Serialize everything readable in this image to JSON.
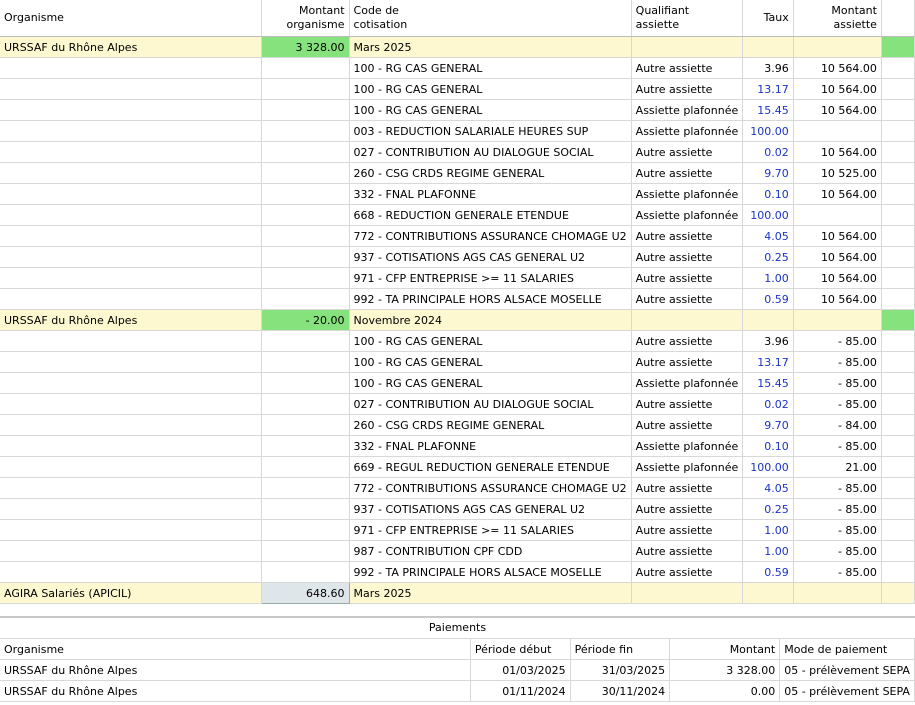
{
  "columns": {
    "organisme": "Organisme",
    "montant_organisme": [
      "Montant",
      "organisme"
    ],
    "code_cotisation": [
      "Code de",
      "cotisation"
    ],
    "qualifiant_assiette": [
      "Qualifiant",
      "assiette"
    ],
    "taux": "Taux",
    "montant_assiette": [
      "Montant",
      "assiette"
    ]
  },
  "groups": [
    {
      "organisme": "URSSAF du Rhône Alpes",
      "montant": "3 328.00",
      "periode": "Mars 2025",
      "rows": [
        {
          "code": "100 - RG CAS GENERAL",
          "qual": "Autre assiette",
          "taux": "3.96",
          "taux_blue": false,
          "assiette": "10 564.00"
        },
        {
          "code": "100 - RG CAS GENERAL",
          "qual": "Autre assiette",
          "taux": "13.17",
          "taux_blue": true,
          "assiette": "10 564.00"
        },
        {
          "code": "100 - RG CAS GENERAL",
          "qual": "Assiette plafonnée",
          "taux": "15.45",
          "taux_blue": true,
          "assiette": "10 564.00"
        },
        {
          "code": "003 - REDUCTION SALARIALE HEURES SUP",
          "qual": "Assiette plafonnée",
          "taux": "100.00",
          "taux_blue": true,
          "assiette": ""
        },
        {
          "code": "027 - CONTRIBUTION AU DIALOGUE SOCIAL",
          "qual": "Autre assiette",
          "taux": "0.02",
          "taux_blue": true,
          "assiette": "10 564.00"
        },
        {
          "code": "260 - CSG CRDS REGIME GENERAL",
          "qual": "Autre assiette",
          "taux": "9.70",
          "taux_blue": true,
          "assiette": "10 525.00"
        },
        {
          "code": "332 - FNAL PLAFONNE",
          "qual": "Assiette plafonnée",
          "taux": "0.10",
          "taux_blue": true,
          "assiette": "10 564.00"
        },
        {
          "code": "668 - REDUCTION GENERALE ETENDUE",
          "qual": "Assiette plafonnée",
          "taux": "100.00",
          "taux_blue": true,
          "assiette": ""
        },
        {
          "code": "772 - CONTRIBUTIONS ASSURANCE CHOMAGE U2",
          "qual": "Autre assiette",
          "taux": "4.05",
          "taux_blue": true,
          "assiette": "10 564.00"
        },
        {
          "code": "937 - COTISATIONS AGS CAS GENERAL U2",
          "qual": "Autre assiette",
          "taux": "0.25",
          "taux_blue": true,
          "assiette": "10 564.00"
        },
        {
          "code": "971 - CFP ENTREPRISE >= 11 SALARIES",
          "qual": "Autre assiette",
          "taux": "1.00",
          "taux_blue": true,
          "assiette": "10 564.00"
        },
        {
          "code": "992 - TA PRINCIPALE HORS ALSACE MOSELLE",
          "qual": "Autre assiette",
          "taux": "0.59",
          "taux_blue": true,
          "assiette": "10 564.00"
        }
      ]
    },
    {
      "organisme": "URSSAF du Rhône Alpes",
      "montant": "- 20.00",
      "periode": "Novembre 2024",
      "rows": [
        {
          "code": "100 - RG CAS GENERAL",
          "qual": "Autre assiette",
          "taux": "3.96",
          "taux_blue": false,
          "assiette": "- 85.00"
        },
        {
          "code": "100 - RG CAS GENERAL",
          "qual": "Autre assiette",
          "taux": "13.17",
          "taux_blue": true,
          "assiette": "- 85.00"
        },
        {
          "code": "100 - RG CAS GENERAL",
          "qual": "Assiette plafonnée",
          "taux": "15.45",
          "taux_blue": true,
          "assiette": "- 85.00"
        },
        {
          "code": "027 - CONTRIBUTION AU DIALOGUE SOCIAL",
          "qual": "Autre assiette",
          "taux": "0.02",
          "taux_blue": true,
          "assiette": "- 85.00"
        },
        {
          "code": "260 - CSG CRDS REGIME GENERAL",
          "qual": "Autre assiette",
          "taux": "9.70",
          "taux_blue": true,
          "assiette": "- 84.00"
        },
        {
          "code": "332 - FNAL PLAFONNE",
          "qual": "Assiette plafonnée",
          "taux": "0.10",
          "taux_blue": true,
          "assiette": "- 85.00"
        },
        {
          "code": "669 - REGUL REDUCTION GENERALE ETENDUE",
          "qual": "Assiette plafonnée",
          "taux": "100.00",
          "taux_blue": true,
          "assiette": "21.00"
        },
        {
          "code": "772 - CONTRIBUTIONS ASSURANCE CHOMAGE U2",
          "qual": "Autre assiette",
          "taux": "4.05",
          "taux_blue": true,
          "assiette": "- 85.00"
        },
        {
          "code": "937 - COTISATIONS AGS CAS GENERAL U2",
          "qual": "Autre assiette",
          "taux": "0.25",
          "taux_blue": true,
          "assiette": "- 85.00"
        },
        {
          "code": "971 - CFP ENTREPRISE >= 11 SALARIES",
          "qual": "Autre assiette",
          "taux": "1.00",
          "taux_blue": true,
          "assiette": "- 85.00"
        },
        {
          "code": "987 - CONTRIBUTION CPF CDD",
          "qual": "Autre assiette",
          "taux": "1.00",
          "taux_blue": true,
          "assiette": "- 85.00"
        },
        {
          "code": "992 - TA PRINCIPALE HORS ALSACE MOSELLE",
          "qual": "Autre assiette",
          "taux": "0.59",
          "taux_blue": true,
          "assiette": "- 85.00"
        }
      ]
    },
    {
      "organisme": "AGIRA Salariés (APICIL)",
      "montant": "648.60",
      "periode": "Mars 2025",
      "rows": []
    }
  ],
  "payments": {
    "title": "Paiements",
    "headers": {
      "organisme": "Organisme",
      "debut": "Période début",
      "fin": "Période fin",
      "montant": "Montant",
      "mode": "Mode de paiement"
    },
    "rows": [
      {
        "organisme": "URSSAF du Rhône Alpes",
        "debut": "01/03/2025",
        "fin": "31/03/2025",
        "montant": "3 328.00",
        "mode": "05 - prélèvement SEPA"
      },
      {
        "organisme": "URSSAF du Rhône Alpes",
        "debut": "01/11/2024",
        "fin": "30/11/2024",
        "montant": "0.00",
        "mode": "05 - prélèvement SEPA"
      }
    ]
  },
  "colors": {
    "group_row_bg": "#fdf8cf",
    "amount_green": "#86e27c",
    "taux_blue": "#1c33c8"
  }
}
